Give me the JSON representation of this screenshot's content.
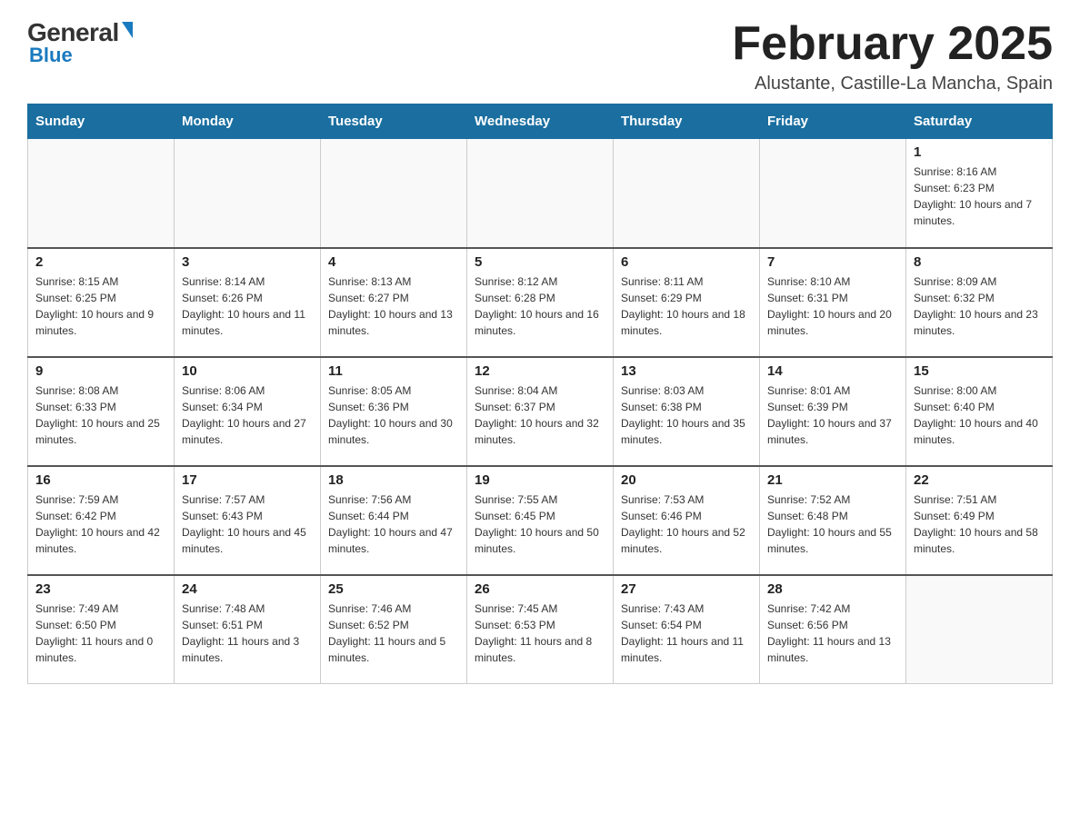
{
  "header": {
    "logo_top": "General",
    "logo_blue": "Blue",
    "title": "February 2025",
    "subtitle": "Alustante, Castille-La Mancha, Spain"
  },
  "days_of_week": [
    "Sunday",
    "Monday",
    "Tuesday",
    "Wednesday",
    "Thursday",
    "Friday",
    "Saturday"
  ],
  "weeks": [
    [
      {
        "day": "",
        "info": ""
      },
      {
        "day": "",
        "info": ""
      },
      {
        "day": "",
        "info": ""
      },
      {
        "day": "",
        "info": ""
      },
      {
        "day": "",
        "info": ""
      },
      {
        "day": "",
        "info": ""
      },
      {
        "day": "1",
        "info": "Sunrise: 8:16 AM\nSunset: 6:23 PM\nDaylight: 10 hours and 7 minutes."
      }
    ],
    [
      {
        "day": "2",
        "info": "Sunrise: 8:15 AM\nSunset: 6:25 PM\nDaylight: 10 hours and 9 minutes."
      },
      {
        "day": "3",
        "info": "Sunrise: 8:14 AM\nSunset: 6:26 PM\nDaylight: 10 hours and 11 minutes."
      },
      {
        "day": "4",
        "info": "Sunrise: 8:13 AM\nSunset: 6:27 PM\nDaylight: 10 hours and 13 minutes."
      },
      {
        "day": "5",
        "info": "Sunrise: 8:12 AM\nSunset: 6:28 PM\nDaylight: 10 hours and 16 minutes."
      },
      {
        "day": "6",
        "info": "Sunrise: 8:11 AM\nSunset: 6:29 PM\nDaylight: 10 hours and 18 minutes."
      },
      {
        "day": "7",
        "info": "Sunrise: 8:10 AM\nSunset: 6:31 PM\nDaylight: 10 hours and 20 minutes."
      },
      {
        "day": "8",
        "info": "Sunrise: 8:09 AM\nSunset: 6:32 PM\nDaylight: 10 hours and 23 minutes."
      }
    ],
    [
      {
        "day": "9",
        "info": "Sunrise: 8:08 AM\nSunset: 6:33 PM\nDaylight: 10 hours and 25 minutes."
      },
      {
        "day": "10",
        "info": "Sunrise: 8:06 AM\nSunset: 6:34 PM\nDaylight: 10 hours and 27 minutes."
      },
      {
        "day": "11",
        "info": "Sunrise: 8:05 AM\nSunset: 6:36 PM\nDaylight: 10 hours and 30 minutes."
      },
      {
        "day": "12",
        "info": "Sunrise: 8:04 AM\nSunset: 6:37 PM\nDaylight: 10 hours and 32 minutes."
      },
      {
        "day": "13",
        "info": "Sunrise: 8:03 AM\nSunset: 6:38 PM\nDaylight: 10 hours and 35 minutes."
      },
      {
        "day": "14",
        "info": "Sunrise: 8:01 AM\nSunset: 6:39 PM\nDaylight: 10 hours and 37 minutes."
      },
      {
        "day": "15",
        "info": "Sunrise: 8:00 AM\nSunset: 6:40 PM\nDaylight: 10 hours and 40 minutes."
      }
    ],
    [
      {
        "day": "16",
        "info": "Sunrise: 7:59 AM\nSunset: 6:42 PM\nDaylight: 10 hours and 42 minutes."
      },
      {
        "day": "17",
        "info": "Sunrise: 7:57 AM\nSunset: 6:43 PM\nDaylight: 10 hours and 45 minutes."
      },
      {
        "day": "18",
        "info": "Sunrise: 7:56 AM\nSunset: 6:44 PM\nDaylight: 10 hours and 47 minutes."
      },
      {
        "day": "19",
        "info": "Sunrise: 7:55 AM\nSunset: 6:45 PM\nDaylight: 10 hours and 50 minutes."
      },
      {
        "day": "20",
        "info": "Sunrise: 7:53 AM\nSunset: 6:46 PM\nDaylight: 10 hours and 52 minutes."
      },
      {
        "day": "21",
        "info": "Sunrise: 7:52 AM\nSunset: 6:48 PM\nDaylight: 10 hours and 55 minutes."
      },
      {
        "day": "22",
        "info": "Sunrise: 7:51 AM\nSunset: 6:49 PM\nDaylight: 10 hours and 58 minutes."
      }
    ],
    [
      {
        "day": "23",
        "info": "Sunrise: 7:49 AM\nSunset: 6:50 PM\nDaylight: 11 hours and 0 minutes."
      },
      {
        "day": "24",
        "info": "Sunrise: 7:48 AM\nSunset: 6:51 PM\nDaylight: 11 hours and 3 minutes."
      },
      {
        "day": "25",
        "info": "Sunrise: 7:46 AM\nSunset: 6:52 PM\nDaylight: 11 hours and 5 minutes."
      },
      {
        "day": "26",
        "info": "Sunrise: 7:45 AM\nSunset: 6:53 PM\nDaylight: 11 hours and 8 minutes."
      },
      {
        "day": "27",
        "info": "Sunrise: 7:43 AM\nSunset: 6:54 PM\nDaylight: 11 hours and 11 minutes."
      },
      {
        "day": "28",
        "info": "Sunrise: 7:42 AM\nSunset: 6:56 PM\nDaylight: 11 hours and 13 minutes."
      },
      {
        "day": "",
        "info": ""
      }
    ]
  ]
}
